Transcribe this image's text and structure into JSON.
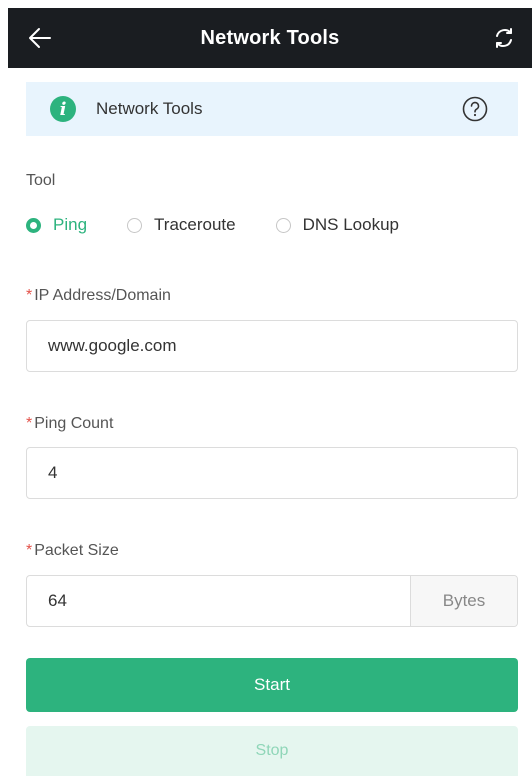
{
  "header": {
    "title": "Network Tools",
    "back_icon": "arrow-left-icon",
    "refresh_icon": "refresh-icon"
  },
  "banner": {
    "icon": "info-icon",
    "text": "Network Tools",
    "help_icon": "help-icon"
  },
  "tool": {
    "label": "Tool",
    "options": [
      "Ping",
      "Traceroute",
      "DNS Lookup"
    ],
    "selected": "Ping"
  },
  "ip_field": {
    "required_mark": "*",
    "label": "IP Address/Domain",
    "value": "www.google.com"
  },
  "ping_count": {
    "required_mark": "*",
    "label": "Ping Count",
    "value": "4"
  },
  "packet_size": {
    "required_mark": "*",
    "label": "Packet Size",
    "value": "64",
    "unit": "Bytes"
  },
  "actions": {
    "start_label": "Start",
    "stop_label": "Stop"
  },
  "colors": {
    "accent": "#2db37e",
    "header_bg": "#1a1d21",
    "banner_bg": "#e8f4fd",
    "required": "#e3524a"
  }
}
